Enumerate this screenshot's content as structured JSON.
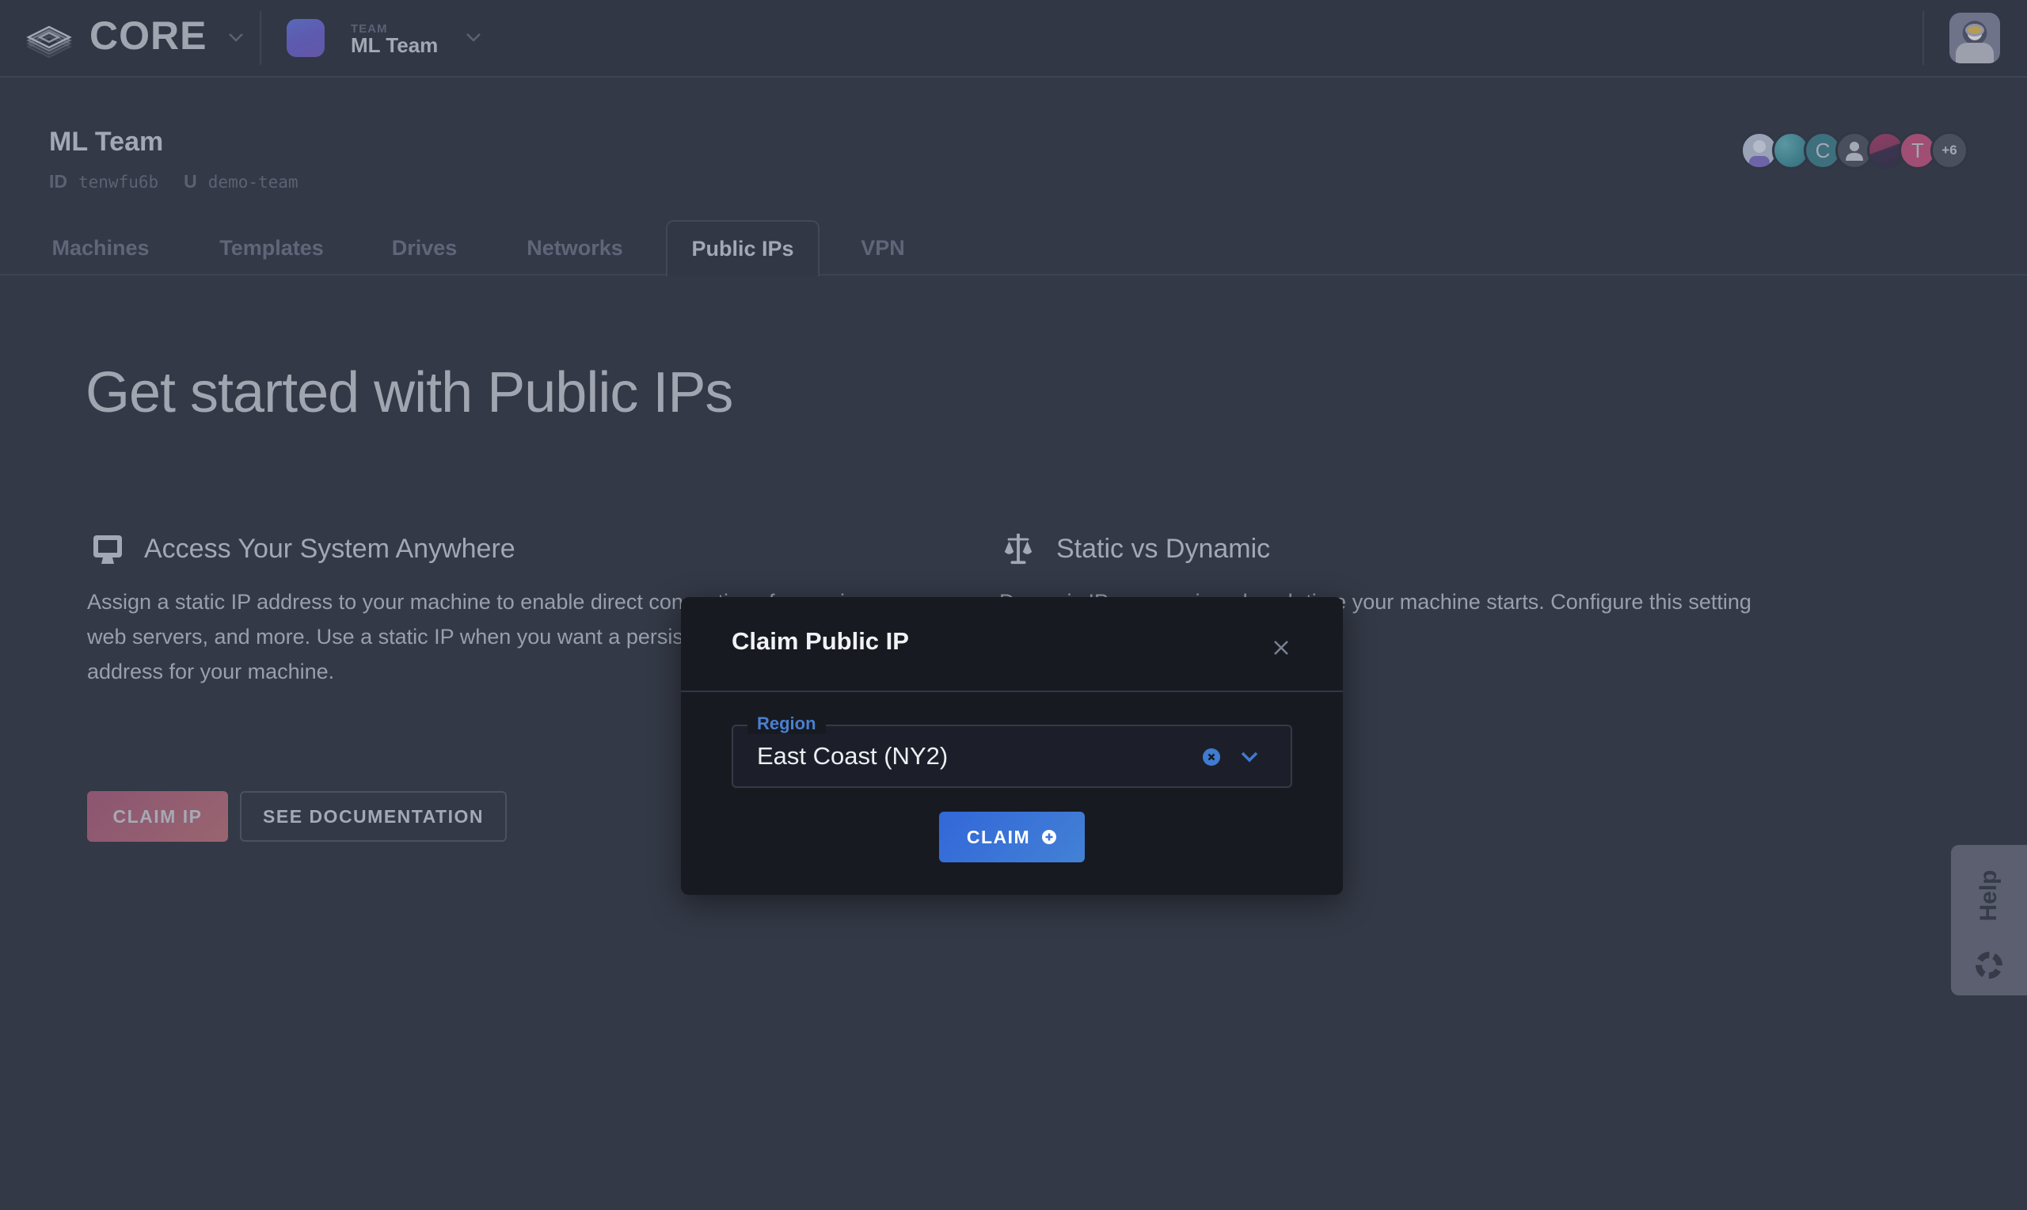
{
  "topbar": {
    "brand": "CORE",
    "team_kicker": "TEAM",
    "team_name": "ML Team"
  },
  "header": {
    "title": "ML Team",
    "id_label": "ID",
    "id_value": "tenwfu6b",
    "u_label": "U",
    "u_value": "demo-team",
    "members": [
      {
        "type": "photo",
        "color": "#9aa2b6"
      },
      {
        "type": "photo",
        "color": "#3f7c8c"
      },
      {
        "type": "initial",
        "initial": "C",
        "color": "#3e6f7c"
      },
      {
        "type": "placeholder",
        "color": "#4a4f5e"
      },
      {
        "type": "photo",
        "color": "#5b3a5c"
      },
      {
        "type": "initial",
        "initial": "T",
        "color": "#a04e73"
      },
      {
        "type": "more",
        "label": "+6",
        "color": "#4a4f5e"
      }
    ]
  },
  "tabs": [
    {
      "label": "Machines",
      "active": false
    },
    {
      "label": "Templates",
      "active": false
    },
    {
      "label": "Drives",
      "active": false
    },
    {
      "label": "Networks",
      "active": false
    },
    {
      "label": "Public IPs",
      "active": true
    },
    {
      "label": "VPN",
      "active": false
    }
  ],
  "main": {
    "hero": "Get started with Public IPs",
    "features": [
      {
        "icon": "monitor-icon",
        "title": "Access Your System Anywhere",
        "lines": [
          "Assign a static IP address to your machine to enable direct connections for services,",
          "web servers, and more. Use a static IP when you want a persistent",
          "address for your machine."
        ]
      },
      {
        "icon": "scale-icon",
        "title": "Static vs Dynamic",
        "lines": [
          "Dynamic IPs are assigned each time your machine starts. Configure this setting"
        ]
      }
    ],
    "claim_ip_label": "CLAIM IP",
    "docs_label": "SEE DOCUMENTATION"
  },
  "help": {
    "label": "Help"
  },
  "modal": {
    "title": "Claim Public IP",
    "region_label": "Region",
    "region_value": "East Coast (NY2)",
    "claim_label": "CLAIM"
  },
  "colors": {
    "accent_blue": "#3a73d8",
    "claim_ip_gradient_start": "#8c5571",
    "background": "#333946",
    "modal_bg": "#171a21"
  }
}
